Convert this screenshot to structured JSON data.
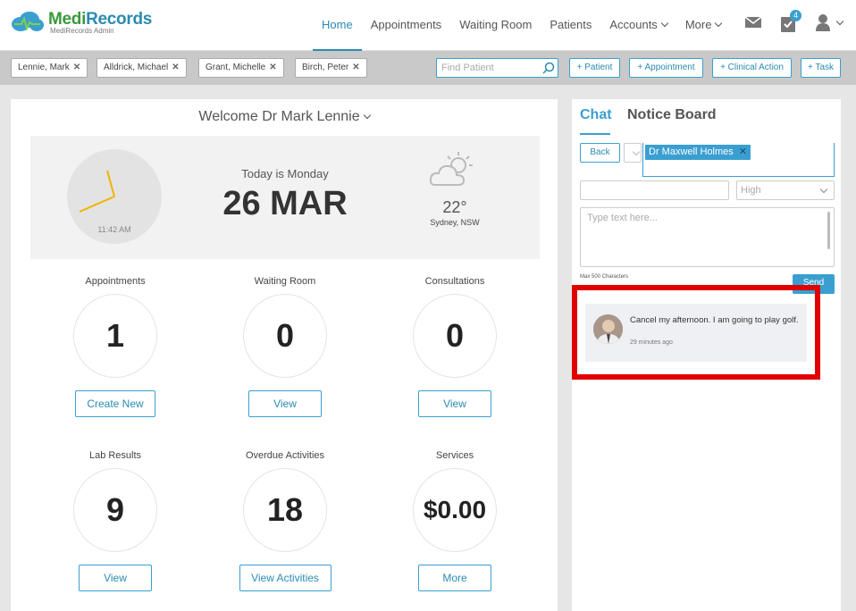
{
  "brand": {
    "name_part1": "Medi",
    "name_part2": "Records",
    "subtitle": "MediRecords Admin"
  },
  "nav": {
    "items": [
      {
        "label": "Home",
        "active": true
      },
      {
        "label": "Appointments"
      },
      {
        "label": "Waiting Room"
      },
      {
        "label": "Patients"
      },
      {
        "label": "Accounts",
        "has_dropdown": true
      },
      {
        "label": "More",
        "has_dropdown": true
      }
    ],
    "mail_icon": "envelope-icon",
    "tasks_icon": "clipboard-check-icon",
    "tasks_count": "4",
    "user_icon": "user-icon"
  },
  "patient_tabs": [
    "Lennie, Mark",
    "Alldrick, Michael",
    "Grant, Michelle",
    "Birch, Peter"
  ],
  "find_patient": {
    "placeholder": "Find Patient"
  },
  "actions": {
    "patient": "+ Patient",
    "appointment": "+ Appointment",
    "clinical": "+ Clinical Action",
    "task": "+ Task"
  },
  "welcome": "Welcome Dr Mark Lennie",
  "hero": {
    "clock_time": "11:42 AM",
    "today": "Today is Monday",
    "date": "26 MAR",
    "temp": "22°",
    "location": "Sydney, NSW",
    "weather_icon": "partly-cloudy-icon"
  },
  "stats": [
    {
      "label": "Appointments",
      "value": "1",
      "button": "Create New"
    },
    {
      "label": "Waiting Room",
      "value": "0",
      "button": "View"
    },
    {
      "label": "Consultations",
      "value": "0",
      "button": "View"
    },
    {
      "label": "Lab Results",
      "value": "9",
      "button": "View"
    },
    {
      "label": "Overdue Activities",
      "value": "18",
      "button": "View Activities"
    },
    {
      "label": "Services",
      "value": "$0.00",
      "button": "More"
    }
  ],
  "chat": {
    "tab_chat": "Chat",
    "tab_notice": "Notice Board",
    "back": "Back",
    "recipient": "Dr Maxwell Holmes",
    "priority": "High",
    "message_placeholder": "Type text here...",
    "max_chars": "Max 500 Characters",
    "send": "Send",
    "message": {
      "text": "Cancel my afternoon. I am going to play golf.",
      "time": "29 minutes ago"
    }
  },
  "colors": {
    "accent": "#3a9fd0",
    "highlight": "#e00000",
    "brand_green": "#3a9a3a"
  }
}
